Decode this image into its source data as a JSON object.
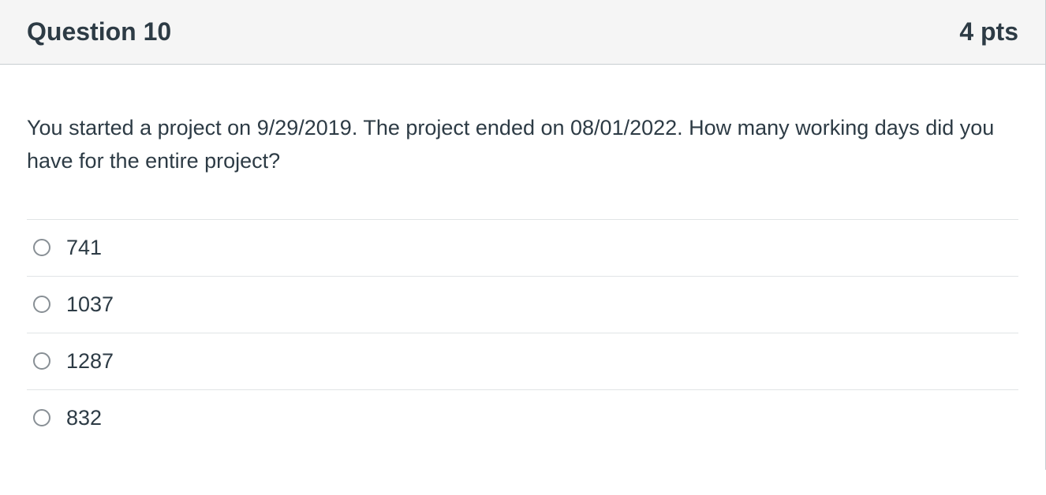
{
  "header": {
    "title": "Question 10",
    "points": "4 pts"
  },
  "question": {
    "text": "You started a project on 9/29/2019. The project ended on 08/01/2022. How many working days did you have for the entire project?"
  },
  "answers": [
    {
      "label": "741"
    },
    {
      "label": "1037"
    },
    {
      "label": "1287"
    },
    {
      "label": "832"
    }
  ]
}
